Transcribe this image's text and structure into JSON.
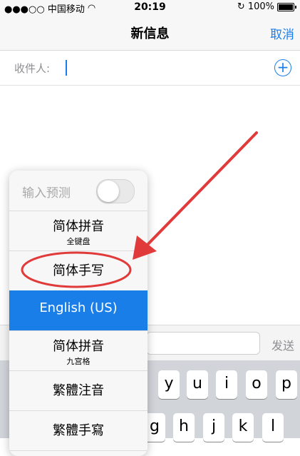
{
  "status_bar": {
    "carrier": "●●●○○ 中国移动",
    "time": "20:19",
    "battery": "100%",
    "battery_level": 1.0
  },
  "nav": {
    "title": "新信息",
    "cancel_label": "取消"
  },
  "recipient": {
    "label": "收件人:"
  },
  "compose": {
    "send_label": "发送"
  },
  "keyboard": {
    "row1": [
      "y",
      "u",
      "i",
      "o",
      "p"
    ],
    "row2": [
      "g",
      "h",
      "j",
      "k",
      "l"
    ]
  },
  "ime_menu": {
    "predictive_label": "输入预测",
    "items": [
      {
        "label": "简体拼音",
        "sublabel": "全键盘"
      },
      {
        "label": "简体手写"
      },
      {
        "label": "English (US)"
      },
      {
        "label": "简体拼音",
        "sublabel": "九宫格"
      },
      {
        "label": "繁體注音"
      },
      {
        "label": "繁體手寫"
      }
    ],
    "selected": "English (US)"
  },
  "colors": {
    "accent": "#1a7ee8",
    "annotation": "#e03a3a"
  }
}
